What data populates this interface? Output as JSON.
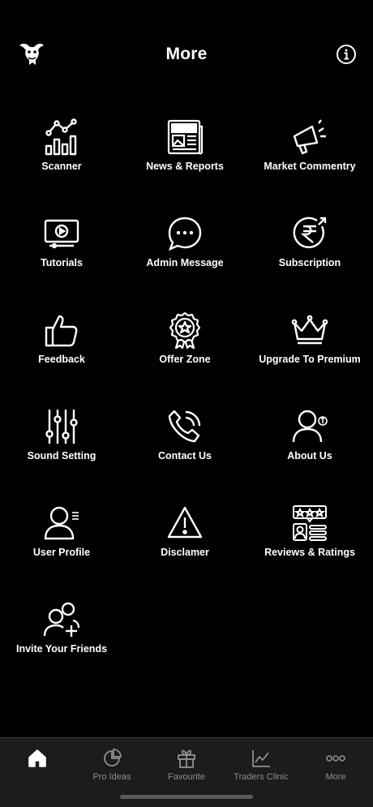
{
  "header": {
    "title": "More",
    "logo_icon": "bull-logo-icon",
    "info_icon": "info-icon"
  },
  "menu": {
    "items": [
      {
        "label": "Scanner",
        "icon": "bar-chart-icon"
      },
      {
        "label": "News & Reports",
        "icon": "newspaper-icon"
      },
      {
        "label": "Market Commentry",
        "icon": "megaphone-icon"
      },
      {
        "label": "Tutorials",
        "icon": "video-monitor-icon"
      },
      {
        "label": "Admin Message",
        "icon": "chat-bubble-icon"
      },
      {
        "label": "Subscription",
        "icon": "rupee-icon"
      },
      {
        "label": "Feedback",
        "icon": "thumbs-up-icon"
      },
      {
        "label": "Offer Zone",
        "icon": "badge-star-icon"
      },
      {
        "label": "Upgrade To Premium",
        "icon": "crown-icon"
      },
      {
        "label": "Sound Setting",
        "icon": "sliders-icon"
      },
      {
        "label": "Contact Us",
        "icon": "phone-icon"
      },
      {
        "label": "About Us",
        "icon": "user-info-icon"
      },
      {
        "label": "User Profile",
        "icon": "user-profile-icon"
      },
      {
        "label": "Disclamer",
        "icon": "warning-icon"
      },
      {
        "label": "Reviews & Ratings",
        "icon": "ratings-icon"
      },
      {
        "label": "Invite Your Friends",
        "icon": "add-users-icon"
      }
    ]
  },
  "tabbar": {
    "tabs": [
      {
        "label": "",
        "icon": "home-icon",
        "active": true
      },
      {
        "label": "Pro Ideas",
        "icon": "pie-chart-icon"
      },
      {
        "label": "Favourite",
        "icon": "gift-icon"
      },
      {
        "label": "Traders Clinic",
        "icon": "line-chart-icon"
      },
      {
        "label": "More",
        "icon": "more-dots-icon"
      }
    ]
  },
  "colors": {
    "background": "#000000",
    "tabbar_background": "#1c1c1e",
    "inactive_tab_label": "#8e8e93",
    "foreground": "#ffffff"
  }
}
